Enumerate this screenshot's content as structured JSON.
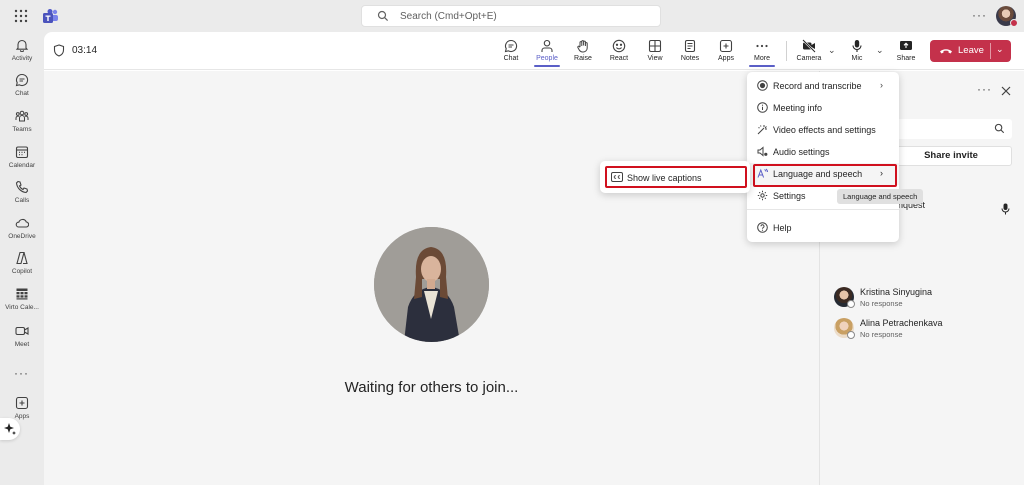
{
  "topbar": {
    "search_placeholder": "Search (Cmd+Opt+E)",
    "more_label": "···"
  },
  "rail": {
    "items": [
      {
        "label": "Activity",
        "icon": "bell-icon"
      },
      {
        "label": "Chat",
        "icon": "chat-icon"
      },
      {
        "label": "Teams",
        "icon": "teams-icon"
      },
      {
        "label": "Calendar",
        "icon": "calendar-icon"
      },
      {
        "label": "Calls",
        "icon": "phone-icon"
      },
      {
        "label": "OneDrive",
        "icon": "cloud-icon"
      },
      {
        "label": "Copilot",
        "icon": "copilot-icon"
      },
      {
        "label": "Virto Cale...",
        "icon": "grid-calendar-icon"
      },
      {
        "label": "Meet",
        "icon": "video-icon"
      },
      {
        "label": "Apps",
        "icon": "plus-square-icon"
      }
    ],
    "more_label": "···"
  },
  "meeting": {
    "timer": "03:14",
    "toolbar": {
      "chat": "Chat",
      "people": "People",
      "raise": "Raise",
      "react": "React",
      "view": "View",
      "notes": "Notes",
      "apps": "Apps",
      "more": "More",
      "camera": "Camera",
      "mic": "Mic",
      "share": "Share",
      "leave": "Leave"
    },
    "waiting_text": "Waiting for others to join..."
  },
  "more_menu": {
    "items": [
      {
        "label": "Record and transcribe",
        "icon": "record-icon",
        "has_submenu": true
      },
      {
        "label": "Meeting info",
        "icon": "info-icon",
        "has_submenu": false
      },
      {
        "label": "Video effects and settings",
        "icon": "magic-wand-icon",
        "has_submenu": false
      },
      {
        "label": "Audio settings",
        "icon": "speaker-icon",
        "has_submenu": false
      },
      {
        "label": "Language and speech",
        "icon": "language-icon",
        "has_submenu": true
      },
      {
        "label": "Settings",
        "icon": "gear-icon",
        "has_submenu": false
      },
      {
        "label": "Help",
        "icon": "help-icon",
        "has_submenu": false
      }
    ],
    "tooltip": "Language and speech"
  },
  "submenu": {
    "item": "Show live captions"
  },
  "panel": {
    "share_invite": "Share invite",
    "partial_name": "nquest",
    "people": [
      {
        "name": "Kristina Sinyugina",
        "status": "No response"
      },
      {
        "name": "Alina Petrachenkava",
        "status": "No response"
      }
    ]
  },
  "colors": {
    "accent": "#5b5fc7",
    "leave": "#c4314b",
    "highlight_border": "#d0101e"
  }
}
